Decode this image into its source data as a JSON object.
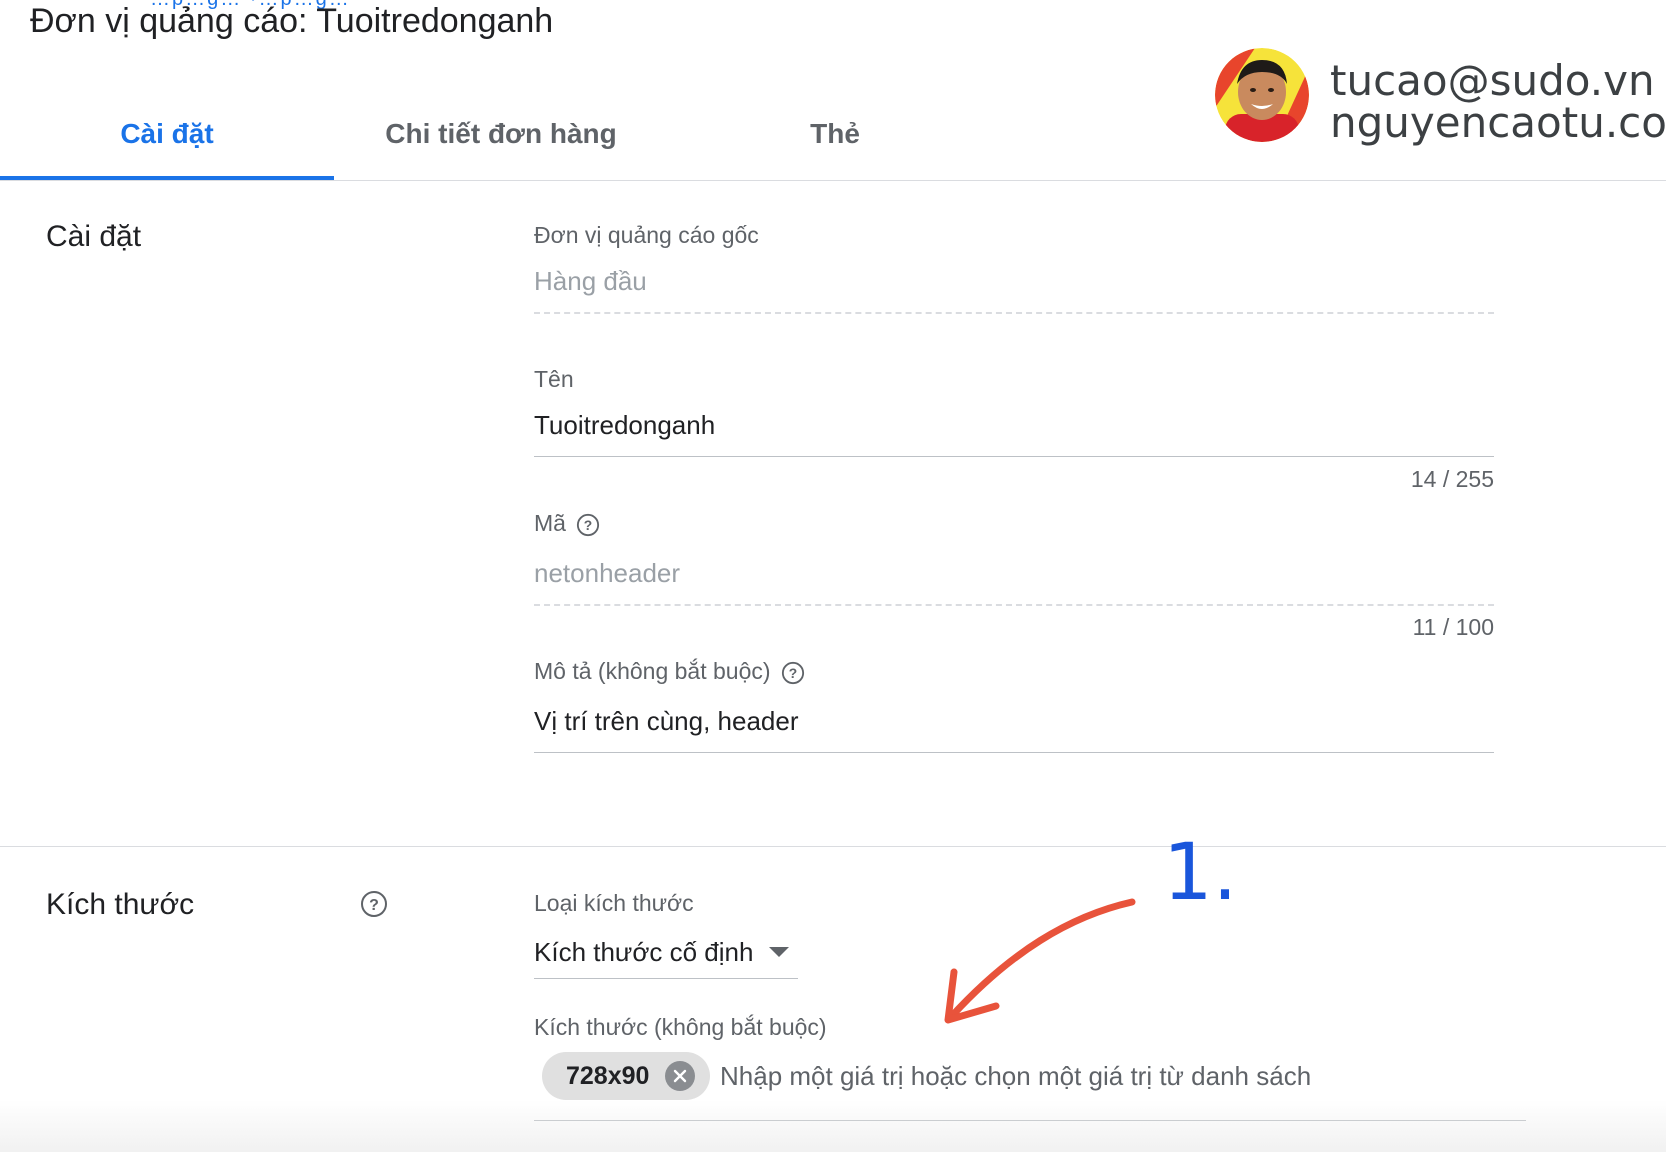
{
  "header": {
    "title": "Đơn vị quảng cáo: Tuoitredonganh",
    "breadcrumb_fragment": "…p…g… ·…p…g…"
  },
  "tabs": [
    {
      "label": "Cài đặt",
      "active": true
    },
    {
      "label": "Chi tiết đơn hàng",
      "active": false
    },
    {
      "label": "Thẻ",
      "active": false
    }
  ],
  "overlay": {
    "line1": "tucao@sudo.vn",
    "line2": "nguyencaotu.com"
  },
  "settings": {
    "section_title": "Cài đặt",
    "parent_unit": {
      "label": "Đơn vị quảng cáo gốc",
      "value": "Hàng đầu"
    },
    "name": {
      "label": "Tên",
      "value": "Tuoitredonganh",
      "counter": "14 / 255"
    },
    "code": {
      "label": "Mã",
      "value": "netonheader",
      "counter": "11 / 100"
    },
    "description": {
      "label": "Mô tả (không bắt buộc)",
      "value": "Vị trí trên cùng, header"
    }
  },
  "size_section": {
    "section_title": "Kích thước",
    "size_type": {
      "label": "Loại kích thước",
      "selected": "Kích thước cố định"
    },
    "sizes": {
      "label": "Kích thước (không bắt buộc)",
      "chips": [
        "728x90"
      ],
      "placeholder": "Nhập một giá trị hoặc chọn một giá trị từ danh sách"
    }
  },
  "annotation": {
    "step_number": "1.",
    "arrow_color": "#e8533b"
  },
  "colors": {
    "accent": "#1a73e8",
    "annotation_blue": "#1a56db"
  }
}
